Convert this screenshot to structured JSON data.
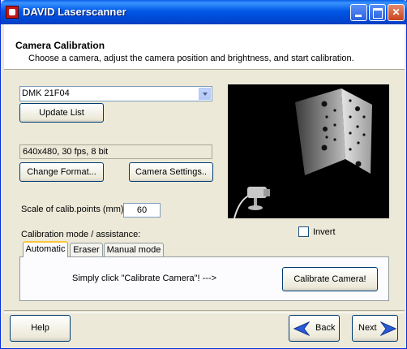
{
  "window": {
    "title": "DAVID Laserscanner"
  },
  "header": {
    "title": "Camera Calibration",
    "subtitle": "Choose a camera, adjust the camera position and brightness, and start calibration."
  },
  "camera": {
    "selected": "DMK 21F04",
    "update_list": "Update List",
    "format_info": "640x480, 30 fps, 8 bit",
    "change_format": "Change Format...",
    "camera_settings": "Camera Settings.."
  },
  "scale": {
    "label": "Scale of calib.points (mm):",
    "value": "60"
  },
  "mode": {
    "label": "Calibration mode / assistance:",
    "tabs": [
      "Automatic",
      "Eraser",
      "Manual mode"
    ],
    "hint": "Simply click \"Calibrate Camera\"!    --->",
    "calibrate": "Calibrate Camera!"
  },
  "invert": {
    "label": "Invert",
    "checked": false
  },
  "footer": {
    "help": "Help",
    "back": "Back",
    "next": "Next"
  },
  "colors": {
    "accent": "#0054e3",
    "tab_highlight": "#ffc83c"
  }
}
